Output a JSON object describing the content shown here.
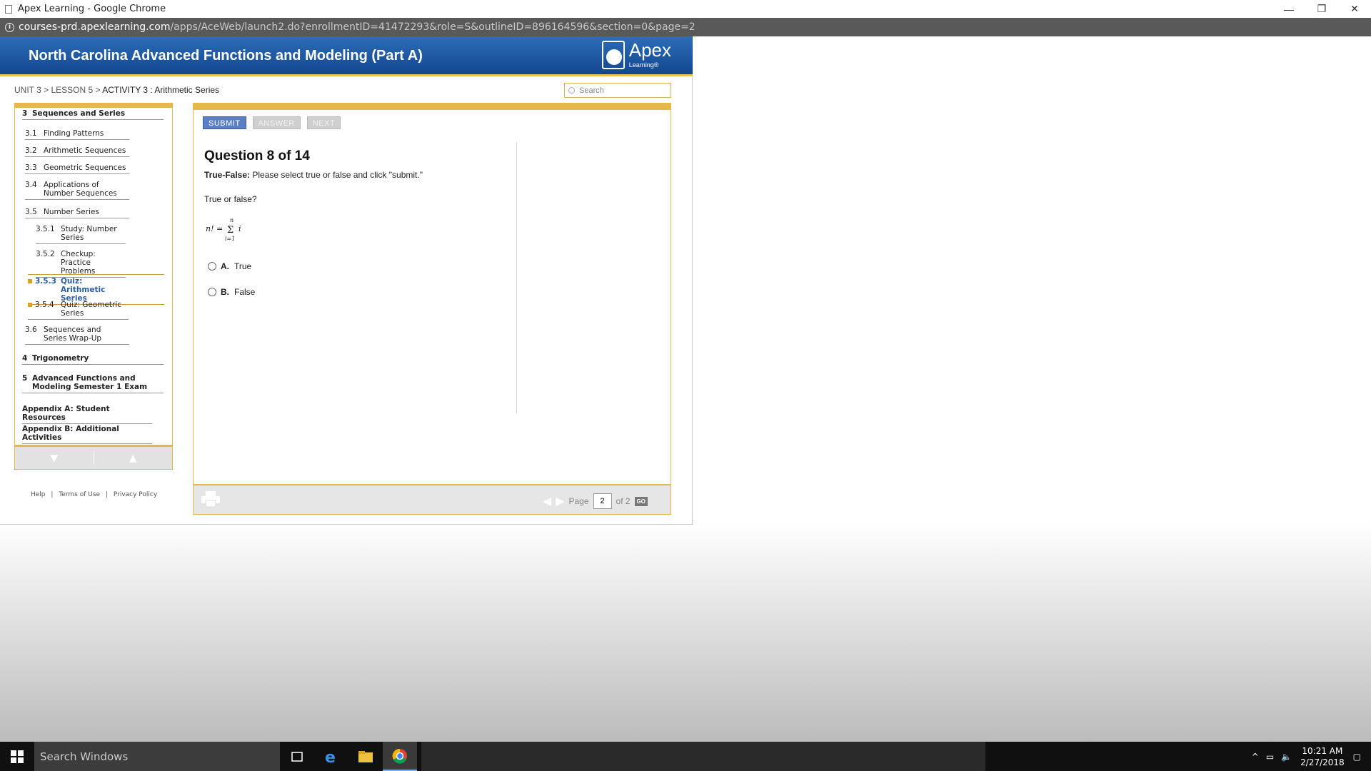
{
  "window": {
    "title": "Apex Learning - Google Chrome",
    "minimize": "—",
    "restore": "❐",
    "close": "✕"
  },
  "address": {
    "host": "courses-prd.apexlearning.com",
    "path": "/apps/AceWeb/launch2.do?enrollmentID=41472293&role=S&outlineID=896164596&section=0&page=2"
  },
  "header": {
    "course_title": "North Carolina Advanced Functions and Modeling (Part A)",
    "logo_word": "Apex",
    "logo_sub": "Learning®"
  },
  "breadcrumb": {
    "unit": "UNIT 3",
    "sep1": " > ",
    "lesson": "LESSON 5",
    "sep2": " > ",
    "activity": "ACTIVITY 3 : Arithmetic Series"
  },
  "search": {
    "placeholder": "Search"
  },
  "sidebar": {
    "unit3": {
      "num": "3",
      "label": "Sequences and Series"
    },
    "items": [
      {
        "num": "3.1",
        "label": "Finding Patterns"
      },
      {
        "num": "3.2",
        "label": "Arithmetic Sequences"
      },
      {
        "num": "3.3",
        "label": "Geometric Sequences"
      },
      {
        "num": "3.4",
        "label": "Applications of Number Sequences"
      },
      {
        "num": "3.5",
        "label": "Number Series"
      },
      {
        "num": "3.5.1",
        "label": "Study: Number Series"
      },
      {
        "num": "3.5.2",
        "label": "Checkup: Practice Problems"
      },
      {
        "num": "3.5.3",
        "label": "Quiz: Arithmetic Series"
      },
      {
        "num": "3.5.4",
        "label": "Quiz: Geometric Series"
      },
      {
        "num": "3.6",
        "label": "Sequences and Series Wrap-Up"
      }
    ],
    "unit4": {
      "num": "4",
      "label": "Trigonometry"
    },
    "unit5": {
      "num": "5",
      "label": "Advanced Functions and Modeling Semester 1 Exam"
    },
    "appendix_a": "Appendix A: Student Resources",
    "appendix_b": "Appendix B: Additional Activities",
    "down_arrow": "▼",
    "up_arrow": "▲"
  },
  "footer_links": {
    "help": "Help",
    "terms": "Terms of Use",
    "privacy": "Privacy Policy",
    "sep": "|"
  },
  "toolbar": {
    "submit": "SUBMIT",
    "answer": "ANSWER",
    "next": "NEXT"
  },
  "question": {
    "title": "Question 8 of 14",
    "instr_label": "True-False:",
    "instr_text": " Please select true or false and click \"submit.\"",
    "prompt": "True or false?",
    "formula_lhs": "n! =",
    "sum_upper": "n",
    "sum_lower": "i=1",
    "summand": "i",
    "choices": [
      {
        "letter": "A.",
        "label": "True"
      },
      {
        "letter": "B.",
        "label": "False"
      }
    ]
  },
  "pager": {
    "page_label": "Page",
    "page_value": "2",
    "of_label": "of 2",
    "go": "GO"
  },
  "taskbar": {
    "search": "Search Windows",
    "time": "10:21 AM",
    "date": "2/27/2018"
  }
}
